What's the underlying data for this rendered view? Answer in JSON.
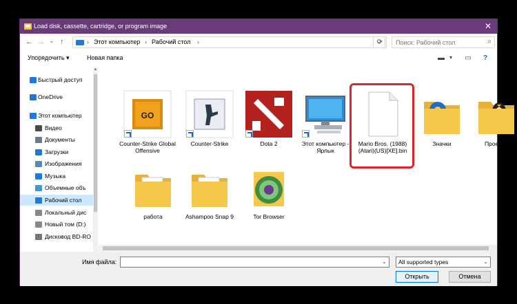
{
  "window": {
    "title": "Load disk, cassette, cartridge, or program image",
    "close": "✕"
  },
  "nav": {
    "back": "←",
    "forward": "→",
    "recent": "⌄",
    "up": "↑",
    "breadcrumbs": [
      "Этот компьютер",
      "Рабочий стол"
    ],
    "separator": "›",
    "refresh": "⟳",
    "search_placeholder": "Поиск: Рабочий стол"
  },
  "toolbar": {
    "organize": "Упорядочить ▾",
    "new_folder": "Новая папка",
    "view": "▬",
    "view_dd": "▾",
    "pane": "▭",
    "help": "?"
  },
  "sidebar": {
    "items": [
      {
        "label": "Быстрый доступ",
        "icon": "star-icon",
        "color": "#1f7ad6"
      },
      {
        "label": "OneDrive",
        "icon": "cloud-icon",
        "color": "#1f7ad6"
      },
      {
        "label": "Этот компьютер",
        "icon": "computer-icon",
        "color": "#1f7ad6"
      },
      {
        "label": "Видео",
        "icon": "video-icon",
        "color": "#4b4b4b"
      },
      {
        "label": "Документы",
        "icon": "documents-icon",
        "color": "#6c7a89"
      },
      {
        "label": "Загрузки",
        "icon": "downloads-icon",
        "color": "#1f7ad6"
      },
      {
        "label": "Изображения",
        "icon": "pictures-icon",
        "color": "#5b8bb0"
      },
      {
        "label": "Музыка",
        "icon": "music-icon",
        "color": "#1f7ad6"
      },
      {
        "label": "Объемные объ",
        "icon": "3d-objects-icon",
        "color": "#3a9ad9"
      },
      {
        "label": "Рабочий стол",
        "icon": "desktop-icon",
        "color": "#1f7ad6",
        "selected": true
      },
      {
        "label": "Локальный дис",
        "icon": "drive-icon",
        "color": "#888888"
      },
      {
        "label": "Новый том (D:)",
        "icon": "drive-icon",
        "color": "#888888"
      },
      {
        "label": "Дисковод BD-RO",
        "icon": "optical-drive-icon",
        "color": "#777777"
      }
    ]
  },
  "files": [
    {
      "label": "Counter-Strike Global Offensive",
      "icon": "csgo-icon",
      "shortcut": true
    },
    {
      "label": "Counter-Strike",
      "icon": "counter-strike-icon",
      "shortcut": true
    },
    {
      "label": "Dota 2",
      "icon": "dota2-icon",
      "shortcut": true
    },
    {
      "label": "Этот компьютер - Ярлык",
      "icon": "computer-icon",
      "shortcut": true
    },
    {
      "label": "Mario Bros. (1988)(Atari)(US)[XE].bin",
      "icon": "file-icon",
      "shortcut": false,
      "highlighted": true
    },
    {
      "label": "Значки",
      "icon": "folder-gear-icon",
      "shortcut": false
    },
    {
      "label": "Проекты",
      "icon": "folder-penguin-icon",
      "shortcut": false
    },
    {
      "label": "работа",
      "icon": "folder-icon",
      "shortcut": false
    },
    {
      "label": "Ashampoo Snap 9",
      "icon": "folder-icon",
      "shortcut": false
    },
    {
      "label": "Tor Browser",
      "icon": "tor-browser-icon",
      "shortcut": false
    }
  ],
  "bottom": {
    "filename_label": "Имя файла:",
    "filename_value": "",
    "filetype_value": "All supported types",
    "open": "Открыть",
    "cancel": "Отмена",
    "dropdown": "⌄"
  },
  "colors": {
    "titlebar": "#6b3a7a",
    "highlight": "#e0242c",
    "folder": "#f5c84b"
  }
}
